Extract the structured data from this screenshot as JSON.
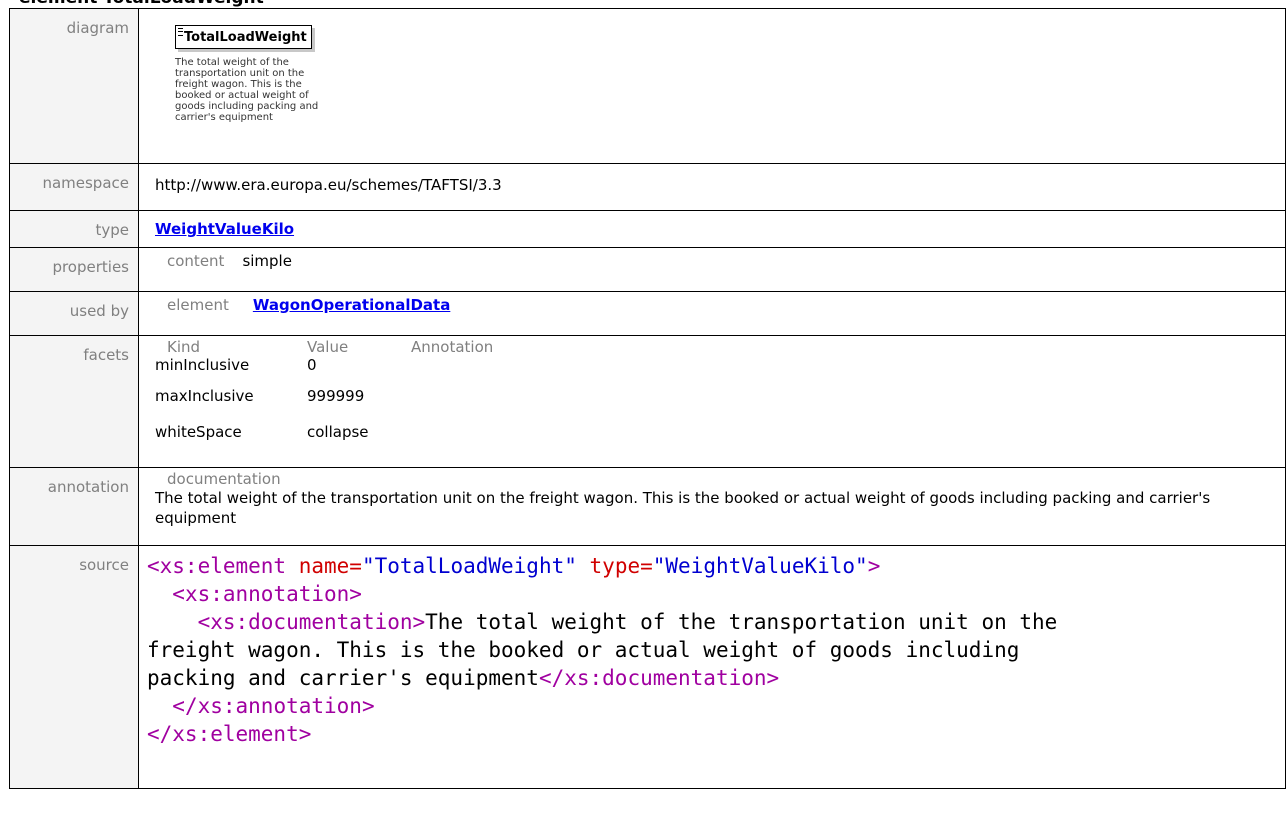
{
  "page": {
    "heading": "element TotalLoadWeight"
  },
  "diagram": {
    "label": "diagram",
    "element_name": "TotalLoadWeight",
    "element_doc": "The total weight of the transportation unit on the freight wagon. This is the booked or actual weight of goods including packing and carrier's equipment"
  },
  "namespace": {
    "label": "namespace",
    "value": "http://www.era.europa.eu/schemes/TAFTSI/3.3"
  },
  "type": {
    "label": "type",
    "value": "WeightValueKilo"
  },
  "properties": {
    "label": "properties",
    "key": "content",
    "value": "simple"
  },
  "used_by": {
    "label": "used by",
    "key": "element",
    "value": "WagonOperationalData"
  },
  "facets": {
    "label": "facets",
    "headers": [
      "Kind",
      "Value",
      "Annotation"
    ],
    "rows": [
      {
        "kind": "minInclusive",
        "value": "0",
        "annotation": ""
      },
      {
        "kind": "maxInclusive",
        "value": "999999",
        "annotation": ""
      },
      {
        "kind": "whiteSpace",
        "value": "collapse",
        "annotation": ""
      }
    ]
  },
  "annotation": {
    "label": "annotation",
    "head": "documentation",
    "text": "The total weight of the transportation unit on the freight wagon. This is the booked or actual weight of goods including packing and carrier's equipment"
  },
  "source": {
    "label": "source",
    "line1_open": "<xs:element ",
    "line1_attr1": "name=",
    "line1_val1": "\"TotalLoadWeight\"",
    "line1_attr2": "type=",
    "line1_val2": "\"WeightValueKilo\"",
    "line1_close": ">",
    "line2": "<xs:annotation>",
    "line3_open": "<xs:documentation>",
    "line3_text": "The total weight of the transportation unit on the",
    "line4_text": "freight wagon. This is the booked or actual weight of goods including",
    "line5_text": "packing and carrier's equipment",
    "line5_close": "</xs:documentation>",
    "line6": "</xs:annotation>",
    "line7": "</xs:element>"
  }
}
